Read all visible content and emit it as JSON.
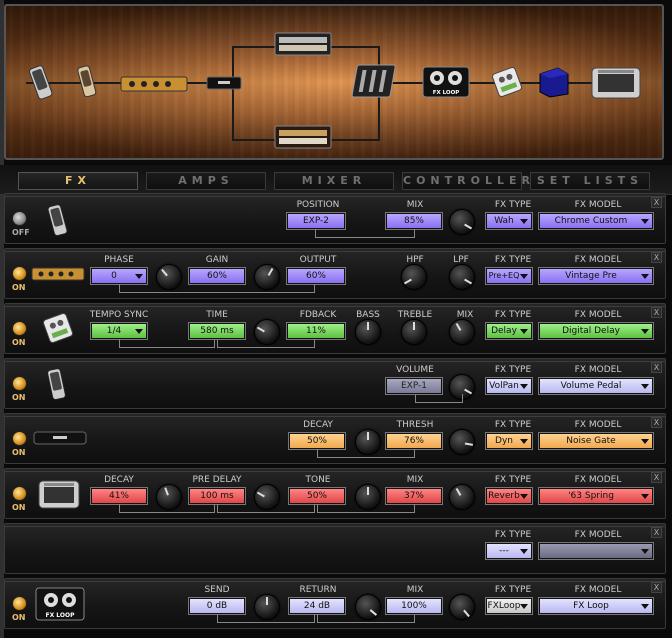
{
  "tabs": [
    "FX",
    "AMPS",
    "MIXER",
    "CONTROLLERS",
    "SET LISTS"
  ],
  "chain": {
    "fx_loop_label": "FX LOOP"
  },
  "close": "X",
  "rows": [
    {
      "switch": "OFF",
      "controls": [
        {
          "label": "POSITION",
          "value": "EXP-2"
        },
        {
          "label": "MIX",
          "value": "85%"
        }
      ],
      "fx_type_label": "FX TYPE",
      "fx_type": "Wah",
      "fx_model_label": "FX MODEL",
      "fx_model": "Chrome Custom"
    },
    {
      "switch": "ON",
      "controls": [
        {
          "label": "PHASE",
          "value": "0"
        },
        {
          "label": "GAIN",
          "value": "60%"
        },
        {
          "label": "OUTPUT",
          "value": "60%"
        },
        {
          "label": "HPF",
          "value": ""
        },
        {
          "label": "LPF",
          "value": ""
        }
      ],
      "fx_type_label": "FX TYPE",
      "fx_type": "Pre+EQ",
      "fx_model_label": "FX MODEL",
      "fx_model": "Vintage Pre"
    },
    {
      "switch": "ON",
      "controls": [
        {
          "label": "TEMPO SYNC",
          "value": "1/4"
        },
        {
          "label": "TIME",
          "value": "580 ms"
        },
        {
          "label": "FDBACK",
          "value": "11%"
        },
        {
          "label": "BASS",
          "value": ""
        },
        {
          "label": "TREBLE",
          "value": ""
        },
        {
          "label": "MIX",
          "value": ""
        }
      ],
      "fx_type_label": "FX TYPE",
      "fx_type": "Delay",
      "fx_model_label": "FX MODEL",
      "fx_model": "Digital Delay"
    },
    {
      "switch": "ON",
      "controls": [
        {
          "label": "VOLUME",
          "value": "EXP-1"
        }
      ],
      "fx_type_label": "FX TYPE",
      "fx_type": "VolPan",
      "fx_model_label": "FX MODEL",
      "fx_model": "Volume Pedal"
    },
    {
      "switch": "ON",
      "controls": [
        {
          "label": "DECAY",
          "value": "50%"
        },
        {
          "label": "THRESH",
          "value": "76%"
        }
      ],
      "fx_type_label": "FX TYPE",
      "fx_type": "Dyn",
      "fx_model_label": "FX MODEL",
      "fx_model": "Noise Gate"
    },
    {
      "switch": "ON",
      "controls": [
        {
          "label": "DECAY",
          "value": "41%"
        },
        {
          "label": "PRE DELAY",
          "value": "100 ms"
        },
        {
          "label": "TONE",
          "value": "50%"
        },
        {
          "label": "MIX",
          "value": "37%"
        }
      ],
      "fx_type_label": "FX TYPE",
      "fx_type": "Reverb",
      "fx_model_label": "FX MODEL",
      "fx_model": "'63 Spring"
    },
    {
      "switch": "",
      "controls": [],
      "fx_type_label": "FX TYPE",
      "fx_type": "---",
      "fx_model_label": "FX MODEL",
      "fx_model": ""
    },
    {
      "switch": "ON",
      "controls": [
        {
          "label": "SEND",
          "value": "0 dB"
        },
        {
          "label": "RETURN",
          "value": "24 dB"
        },
        {
          "label": "MIX",
          "value": "100%"
        }
      ],
      "fx_type_label": "FX TYPE",
      "fx_type": "FXLoop",
      "fx_model_label": "FX MODEL",
      "fx_model": "FX Loop"
    }
  ],
  "colors": {
    "wah": "#9a82f8",
    "pre": "#9a82f8",
    "delay": "#7cdc64",
    "volume": "#8e8ea8",
    "dyn": "#f4b868",
    "reverb": "#ee5c5c",
    "loop": "#d0d0fa",
    "active_tab": "#e8c070"
  }
}
